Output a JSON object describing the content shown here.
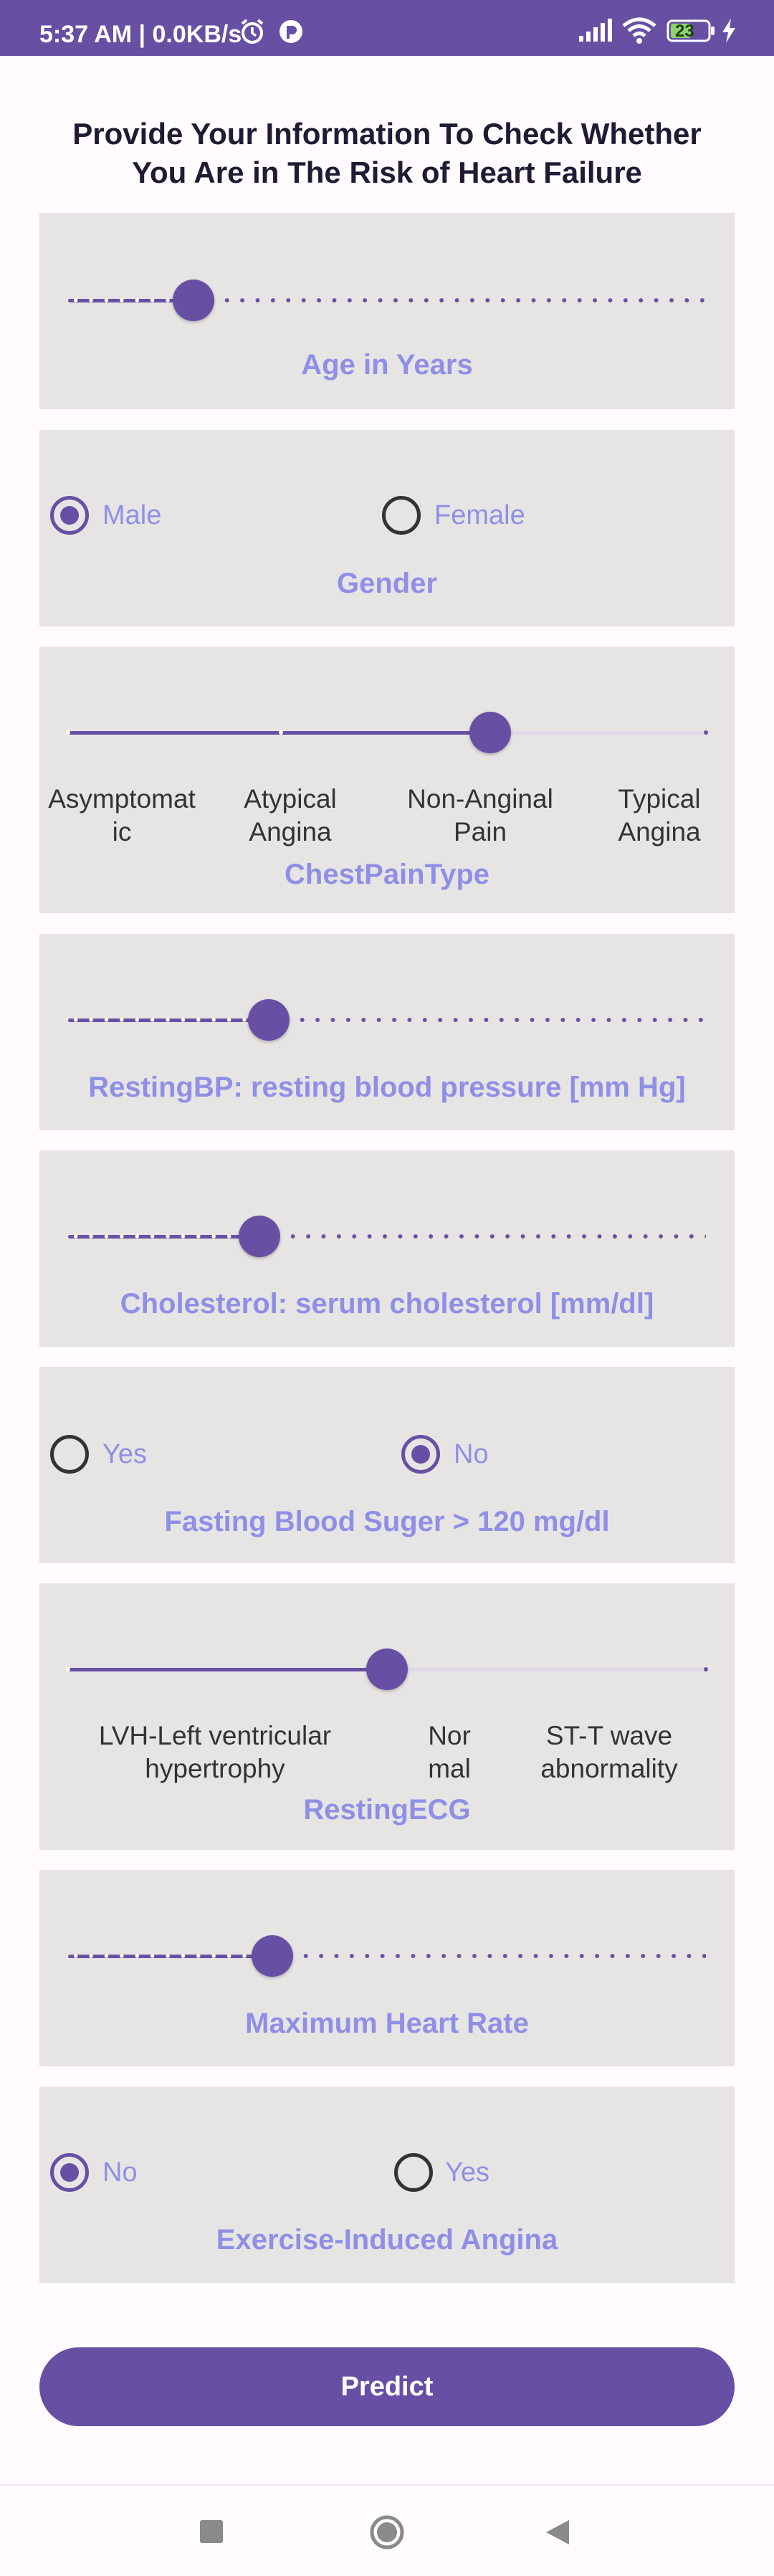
{
  "status_bar": {
    "time_text": "5:37 AM | 0.0KB/s",
    "battery_level": "23"
  },
  "page": {
    "title": "Provide Your Information To Check Whether You Are in The Risk of Heart Failure"
  },
  "fields": {
    "age": {
      "label": "Age in Years",
      "slider_position": 0.18
    },
    "gender": {
      "label": "Gender",
      "options": [
        "Male",
        "Female"
      ],
      "selected": "Male"
    },
    "chest_pain": {
      "label": "ChestPainType",
      "options": [
        "Asymptomat ic",
        "Atypical Angina",
        "Non-Anginal Pain",
        "Typical Angina"
      ],
      "selected": "Non-Anginal Pain"
    },
    "resting_bp": {
      "label": "RestingBP: resting blood pressure [mm Hg]",
      "slider_position": 0.3
    },
    "cholesterol": {
      "label": "Cholesterol: serum cholesterol [mm/dl]",
      "slider_position": 0.28
    },
    "fasting_bs": {
      "label": "Fasting Blood Suger > 120 mg/dl",
      "options": [
        "Yes",
        "No"
      ],
      "selected": "No"
    },
    "resting_ecg": {
      "label": "RestingECG",
      "options": [
        "LVH-Left ventricular hypertrophy",
        "Nor mal",
        "ST-T wave abnormality"
      ],
      "selected": "Nor mal"
    },
    "max_hr": {
      "label": "Maximum Heart Rate",
      "slider_position": 0.31
    },
    "exercise_angina": {
      "label": "Exercise-Induced Angina",
      "options": [
        "No",
        "Yes"
      ],
      "selected": "No"
    }
  },
  "predict_button_label": "Predict",
  "nav": {
    "recents_icon": "square-icon",
    "home_icon": "circle-icon",
    "back_icon": "triangle-back-icon"
  },
  "colors": {
    "primary": "#6750a4",
    "label_accent": "#8f8fe6",
    "card_bg": "#e7e5e4"
  }
}
